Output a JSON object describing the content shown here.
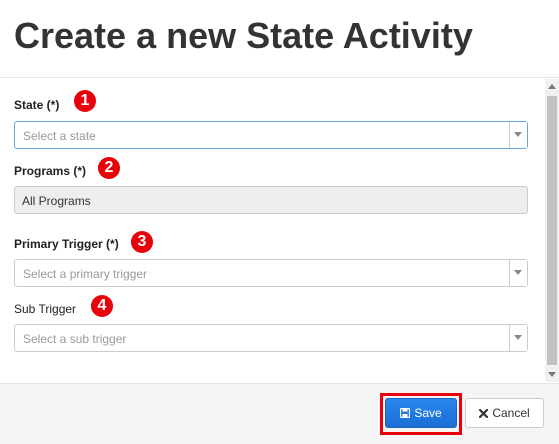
{
  "modal": {
    "title": "Create a new State Activity"
  },
  "fields": {
    "state": {
      "label": "State (*)",
      "badge": "1",
      "placeholder": "Select a state"
    },
    "programs": {
      "label": "Programs (*)",
      "badge": "2",
      "value": "All Programs"
    },
    "primary_trigger": {
      "label": "Primary Trigger (*)",
      "badge": "3",
      "placeholder": "Select a primary trigger"
    },
    "sub_trigger": {
      "label": "Sub Trigger",
      "badge": "4",
      "placeholder": "Select a sub trigger"
    }
  },
  "footer": {
    "save_label": "Save",
    "cancel_label": "Cancel"
  },
  "icons": {
    "dropdown": "caret-down-icon",
    "save": "floppy-disk-icon",
    "cancel": "close-icon",
    "scroll_up": "scroll-up-arrow-icon",
    "scroll_down": "scroll-down-arrow-icon"
  },
  "colors": {
    "badge": "#e8000b",
    "save_button": "#1f7ae0",
    "focus_border": "#66a5dd",
    "highlight_border": "#e8000b"
  }
}
